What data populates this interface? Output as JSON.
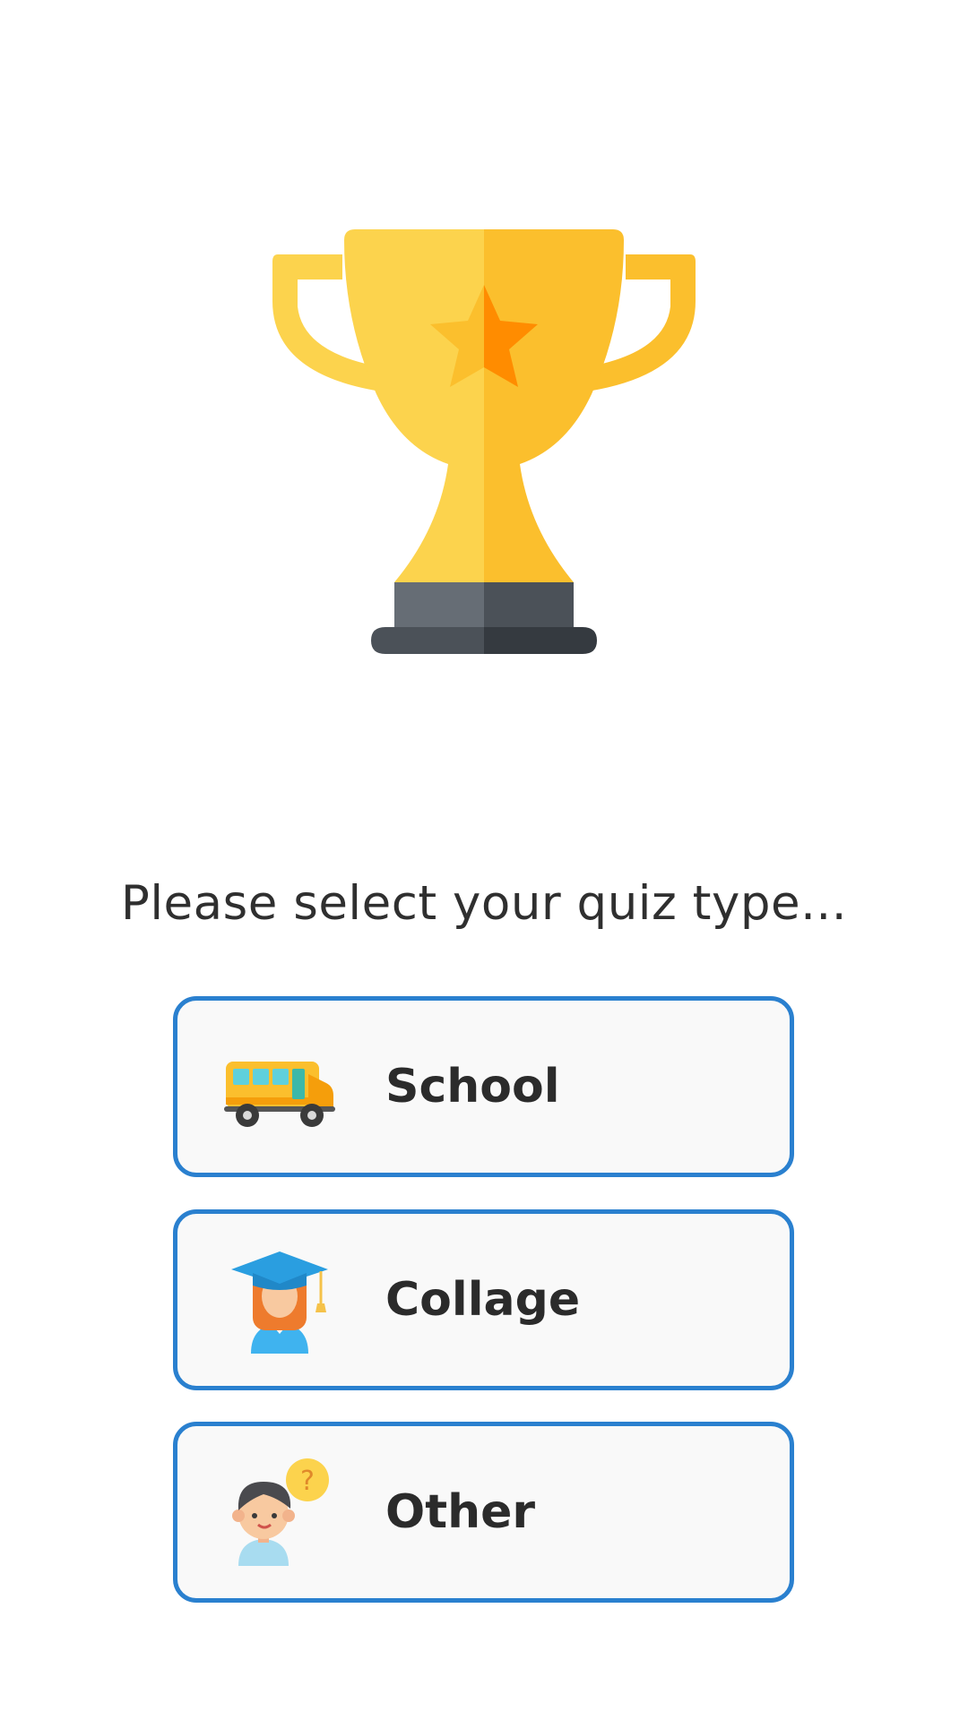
{
  "prompt_text": "Please select your quiz type...",
  "options": [
    {
      "label": "School",
      "icon": "school-bus-icon"
    },
    {
      "label": "Collage",
      "icon": "graduate-student-icon"
    },
    {
      "label": "Other",
      "icon": "person-question-icon"
    }
  ],
  "colors": {
    "background": "#ffffff",
    "option_border": "#2a80cf",
    "option_fill": "#f9f9f9",
    "text": "#2b2b2b",
    "trophy_gold": "#fcd34d",
    "trophy_gold_shade": "#fbbf2d",
    "trophy_base": "#5f6670"
  },
  "header_icon": "trophy-icon"
}
